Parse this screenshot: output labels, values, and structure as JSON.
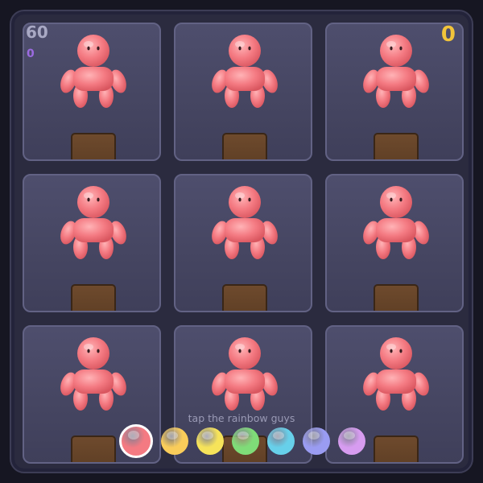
{
  "hud": {
    "timer": "60",
    "combo": "0",
    "score": "0"
  },
  "hint": "tap the rainbow guys",
  "grid": {
    "rows": 3,
    "cols": 3,
    "cells": [
      {
        "figure": "rainbow-guy",
        "color": "#f47a82"
      },
      {
        "figure": "rainbow-guy",
        "color": "#f47a82"
      },
      {
        "figure": "rainbow-guy",
        "color": "#f47a82"
      },
      {
        "figure": "rainbow-guy",
        "color": "#f47a82"
      },
      {
        "figure": "rainbow-guy",
        "color": "#f47a82"
      },
      {
        "figure": "rainbow-guy",
        "color": "#f47a82"
      },
      {
        "figure": "rainbow-guy",
        "color": "#f47a82"
      },
      {
        "figure": "rainbow-guy",
        "color": "#f47a82"
      },
      {
        "figure": "rainbow-guy",
        "color": "#f47a82"
      }
    ]
  },
  "palette": {
    "selected_index": 0,
    "colors": [
      {
        "name": "red",
        "color": "#f47a82"
      },
      {
        "name": "orange-yellow",
        "color": "#f9cc5a"
      },
      {
        "name": "yellow",
        "color": "#f6e35a"
      },
      {
        "name": "green",
        "color": "#7fdc78"
      },
      {
        "name": "cyan",
        "color": "#67d0ea"
      },
      {
        "name": "indigo",
        "color": "#9a9cf2"
      },
      {
        "name": "violet",
        "color": "#d79cf0"
      }
    ]
  },
  "colors": {
    "background": "#161622",
    "board": "#2b2b3f",
    "cell": "#4a4a67",
    "pit": "#5f3f25",
    "score": "#f2c43a",
    "timer": "#a9a9c4",
    "combo": "#9b6be0"
  }
}
